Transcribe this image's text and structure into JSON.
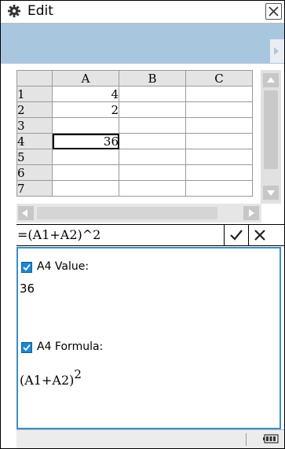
{
  "menu": {
    "label": "Edit",
    "gear_icon": "gear-icon",
    "close_icon": "close-icon"
  },
  "sheet": {
    "columns": [
      "A",
      "B",
      "C"
    ],
    "rows": [
      {
        "num": "1",
        "cells": [
          "4",
          "",
          ""
        ]
      },
      {
        "num": "2",
        "cells": [
          "2",
          "",
          ""
        ]
      },
      {
        "num": "3",
        "cells": [
          "",
          "",
          ""
        ]
      },
      {
        "num": "4",
        "cells": [
          "36",
          "",
          ""
        ]
      },
      {
        "num": "5",
        "cells": [
          "",
          "",
          ""
        ]
      },
      {
        "num": "6",
        "cells": [
          "",
          "",
          ""
        ]
      },
      {
        "num": "7",
        "cells": [
          "",
          "",
          ""
        ]
      }
    ],
    "selected_cell": "A4"
  },
  "formula_bar": {
    "value": "=(A1+A2)^2"
  },
  "results": {
    "value_label": "A4 Value:",
    "value": "36",
    "formula_label": "A4 Formula:",
    "formula_base": "(A1+A2)",
    "formula_exponent": "2"
  },
  "colors": {
    "toolbar": "#a9c6df",
    "panel_border": "#3a8fc9",
    "checkbox": "#1f86d6"
  }
}
